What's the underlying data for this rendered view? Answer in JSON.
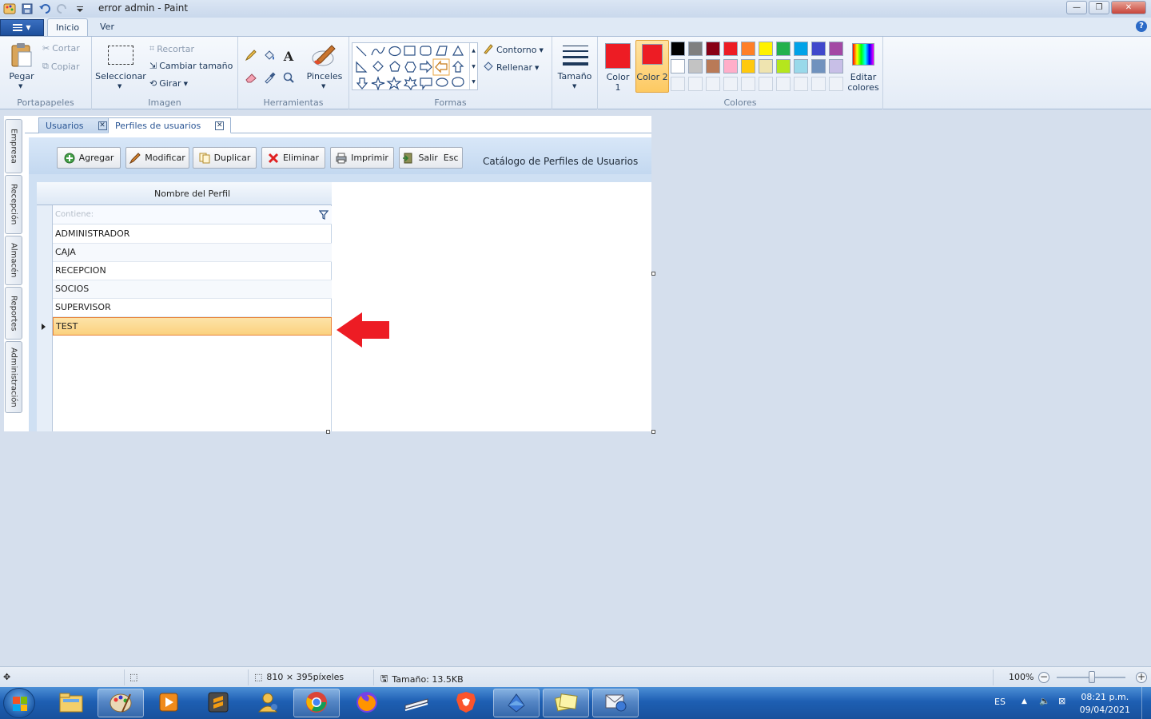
{
  "window": {
    "title": "error admin - Paint"
  },
  "ribbon": {
    "tabs": [
      "Inicio",
      "Ver"
    ],
    "active_tab": "Inicio",
    "portapapeles": {
      "label": "Portapapeles",
      "pegar": "Pegar",
      "cortar": "Cortar",
      "copiar": "Copiar"
    },
    "imagen": {
      "label": "Imagen",
      "seleccionar": "Seleccionar",
      "recortar": "Recortar",
      "cambiar_tamano": "Cambiar tamaño",
      "girar": "Girar"
    },
    "herramientas": {
      "label": "Herramientas",
      "pinceles": "Pinceles"
    },
    "formas": {
      "label": "Formas",
      "contorno": "Contorno",
      "rellenar": "Rellenar"
    },
    "tamano": "Tamaño",
    "colores": {
      "label": "Colores",
      "color1": "Color 1",
      "color2": "Color 2",
      "editar": "Editar colores",
      "color1_value": "#ed1c24",
      "color2_value": "#ed1c24",
      "palette_row1": [
        "#000000",
        "#7f7f7f",
        "#880015",
        "#ed1c24",
        "#ff7f27",
        "#fff200",
        "#22b14c",
        "#00a2e8",
        "#3f48cc",
        "#a349a4"
      ],
      "palette_row2": [
        "#ffffff",
        "#c3c3c3",
        "#b97a57",
        "#ffaec9",
        "#ffc90e",
        "#efe4b0",
        "#b5e61d",
        "#99d9ea",
        "#7092be",
        "#c8bfe7"
      ]
    }
  },
  "app": {
    "side_tabs": [
      "Empresa",
      "Recepción",
      "Almacén",
      "Reportes",
      "Administración"
    ],
    "doc_tabs": [
      {
        "label": "Usuarios",
        "active": false
      },
      {
        "label": "Perfiles de usuarios",
        "active": true
      }
    ],
    "toolbar": {
      "agregar": "Agregar",
      "modificar": "Modificar",
      "duplicar": "Duplicar",
      "eliminar": "Eliminar",
      "imprimir": "Imprimir",
      "salir": "Salir  Esc"
    },
    "catalog_title": "Catálogo de Perfiles de Usuarios",
    "grid": {
      "column_header": "Nombre del Perfil",
      "filter_placeholder": "Contiene:",
      "rows": [
        "ADMINISTRADOR",
        "CAJA",
        "RECEPCION",
        "SOCIOS",
        "SUPERVISOR",
        "TEST"
      ],
      "selected_row": "TEST"
    }
  },
  "statusbar": {
    "dimensions": "810 × 395píxeles",
    "size": "Tamaño: 13.5KB",
    "zoom": "100%"
  },
  "taskbar": {
    "language": "ES",
    "time": "08:21 p.m.",
    "date": "09/04/2021"
  }
}
